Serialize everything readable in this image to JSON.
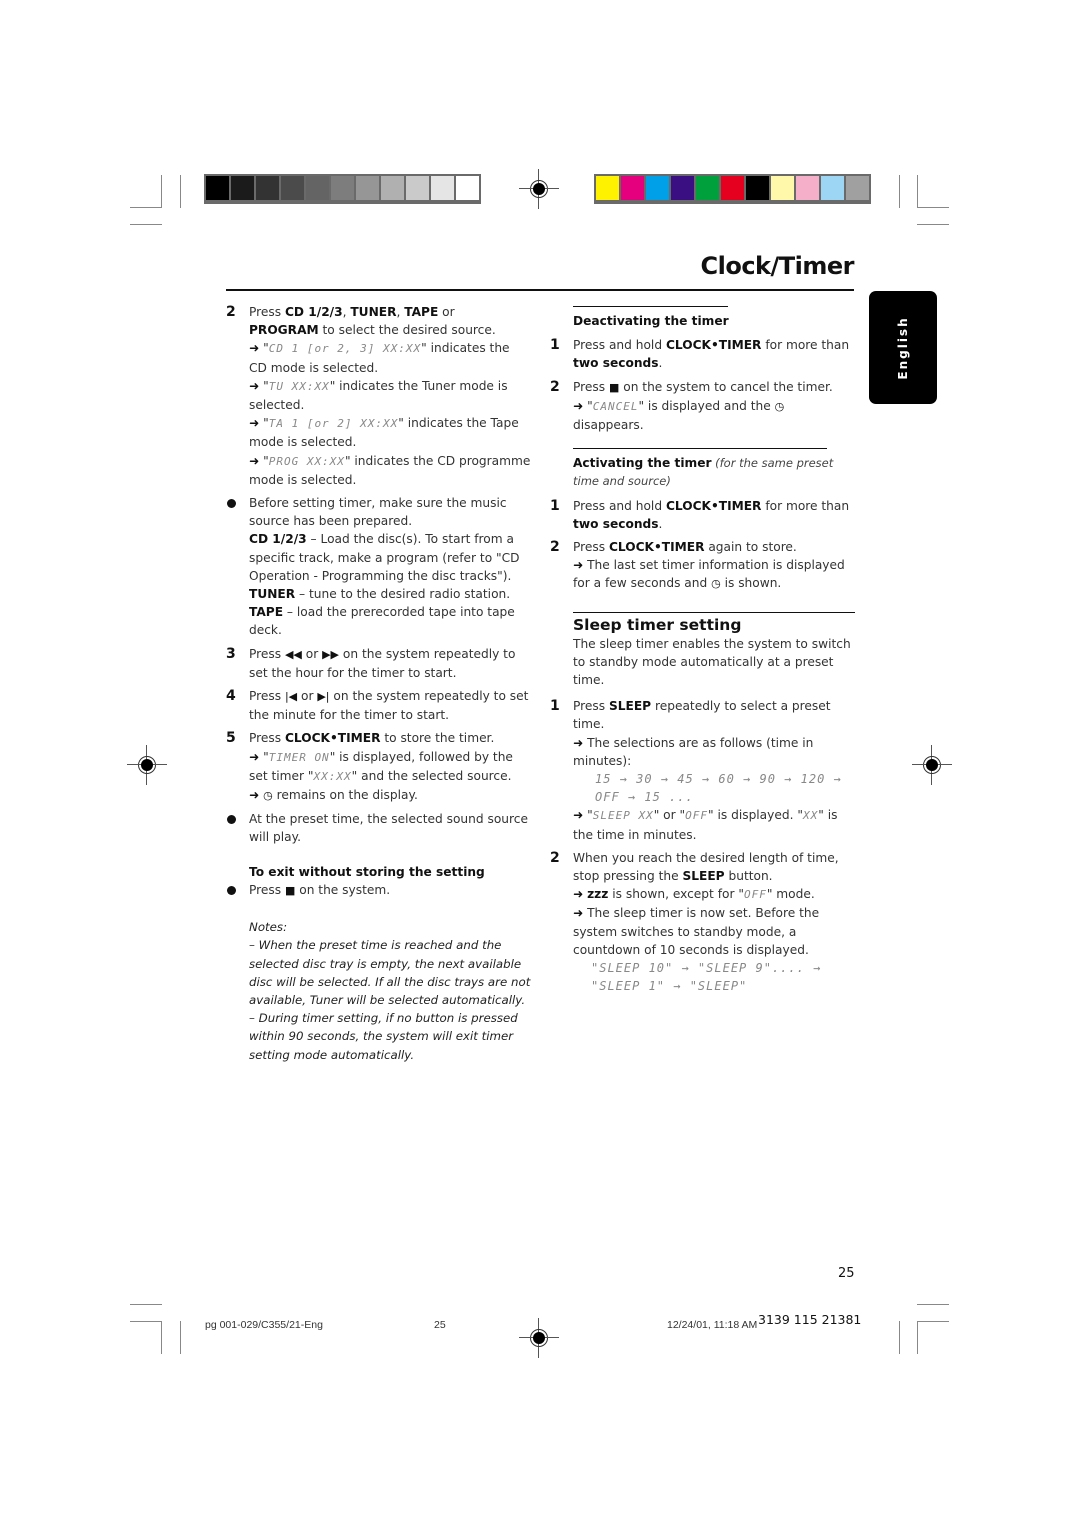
{
  "print_marks": {
    "grayscale_swatches": [
      "#000000",
      "#1b1b1b",
      "#333333",
      "#4b4b4b",
      "#646464",
      "#7d7d7d",
      "#969696",
      "#b0b0b0",
      "#cacaca",
      "#e5e5e5",
      "#ffffff"
    ],
    "color_swatches": [
      "#fff200",
      "#e5007e",
      "#00a0e9",
      "#3a0f82",
      "#00a03c",
      "#e60020",
      "#000000",
      "#fff8aa",
      "#f5afc8",
      "#9dd5f5",
      "#a0a0a0"
    ]
  },
  "header": {
    "title": "Clock/Timer",
    "language_tab": "English"
  },
  "left_column": {
    "step2": {
      "num": "2",
      "press": "Press ",
      "cd": "CD 1/2/3",
      "comma1": ", ",
      "tuner": "TUNER",
      "comma2": ", ",
      "tape": "TAPE",
      "or": " or",
      "program": "PROGRAM",
      "select": " to select the desired source.",
      "cd_lcd": "CD 1 [or 2, 3] XX:XX",
      "cd_text": " indicates the CD mode is selected.",
      "tu_lcd": "TU XX:XX",
      "tu_text": " indicates the Tuner mode is selected.",
      "ta_lcd": "TA 1 [or 2] XX:XX",
      "ta_text": " indicates the Tape mode is selected.",
      "prog_lcd": "PROG XX:XX",
      "prog_text": " indicates the CD programme mode is selected."
    },
    "bullet1": {
      "text": "Before setting timer, make sure the music source has been prepared.",
      "cd_label": "CD 1/2/3",
      "cd_text": " – Load the disc(s). To start from a specific track, make a program (refer to \"CD Operation - Programming the disc tracks\").",
      "tuner_label": "TUNER",
      "tuner_text": " – tune to the desired radio station.",
      "tape_label": "TAPE",
      "tape_text": " – load the prerecorded tape into tape deck."
    },
    "step3": {
      "num": "3",
      "text_a": "Press ",
      "icon_a": "◀◀",
      "text_b": " or ",
      "icon_b": "▶▶",
      "text_c": " on the system repeatedly to set the hour for the timer to start."
    },
    "step4": {
      "num": "4",
      "text_a": "Press ",
      "icon_a": "|◀",
      "text_b": " or ",
      "icon_b": "▶|",
      "text_c": " on the system repeatedly to set the minute for the timer to start."
    },
    "step5": {
      "num": "5",
      "press": "Press ",
      "key": "CLOCK•TIMER",
      "text": " to store the timer.",
      "lcd1": "TIMER ON",
      "text2": " is displayed, followed by the set timer ",
      "lcd2": "XX:XX",
      "text3": " and the selected source.",
      "text4": " remains on the display."
    },
    "bullet2": "At the preset time, the selected sound source will play.",
    "exit": {
      "heading": "To exit without storing the setting",
      "text_a": "Press ",
      "icon": "■",
      "text_b": " on the system."
    },
    "notes": {
      "label": "Notes:",
      "note1": "–  When the preset time is reached and the selected disc tray is empty, the next available disc will be selected.  If all the disc trays are not available, Tuner will be selected automatically.",
      "note2": "–  During timer setting, if no button is pressed within 90 seconds, the system will exit timer setting mode automatically."
    }
  },
  "right_column": {
    "deactivate": {
      "heading": "Deactivating the timer",
      "s1_num": "1",
      "s1_a": "Press and hold ",
      "s1_key": "CLOCK•TIMER",
      "s1_b": " for more than ",
      "s1_c": "two seconds",
      "s1_d": ".",
      "s2_num": "2",
      "s2_a": "Press ",
      "s2_icon": "■",
      "s2_b": " on the system to cancel the timer.",
      "s2_lcd": "CANCEL",
      "s2_c": " is displayed and the ",
      "s2_d": " disappears."
    },
    "activate": {
      "heading": "Activating the timer",
      "heading_note": " (for the same preset time and source)",
      "s1_num": "1",
      "s1_a": "Press and hold ",
      "s1_key": "CLOCK•TIMER",
      "s1_b": " for more than ",
      "s1_c": "two seconds",
      "s1_d": ".",
      "s2_num": "2",
      "s2_a": "Press ",
      "s2_key": "CLOCK•TIMER",
      "s2_b": " again to store.",
      "s2_c": " The last set timer information is displayed for a few seconds and ",
      "s2_d": " is shown."
    },
    "sleep": {
      "title": "Sleep timer setting",
      "intro": "The sleep timer enables the system to switch to standby mode automatically at a preset time.",
      "s1_num": "1",
      "s1_a": "Press ",
      "s1_key": "SLEEP",
      "s1_b": " repeatedly to select a preset time.",
      "s1_c": " The selections are as follows (time in minutes):",
      "sequence": "15 → 30 → 45 → 60 → 90 → 120 → OFF → 15 ...",
      "s1_lcd1": "SLEEP XX",
      "s1_d": " or ",
      "s1_lcd2": "OFF",
      "s1_e": " is displayed. ",
      "s1_lcd3": "XX",
      "s1_f": " is the time in minutes.",
      "s2_num": "2",
      "s2_a": "When you reach the desired length of time, stop pressing the ",
      "s2_key": "SLEEP",
      "s2_b": " button.",
      "s2_zzz": "zzz",
      "s2_c": " is shown, except for ",
      "s2_lcd": "OFF",
      "s2_d": " mode.",
      "s2_e": " The sleep timer is now set. Before the system switches to standby mode, a countdown of 10 seconds is displayed.",
      "countdown": "\"SLEEP 10\" → \"SLEEP 9\".... → \"SLEEP 1\" → \"SLEEP\""
    }
  },
  "footer": {
    "page_number": "25",
    "file": "pg 001-029/C355/21-Eng",
    "page": "25",
    "timestamp": "12/24/01, 11:18 AM",
    "code": "3139 115 21381"
  }
}
